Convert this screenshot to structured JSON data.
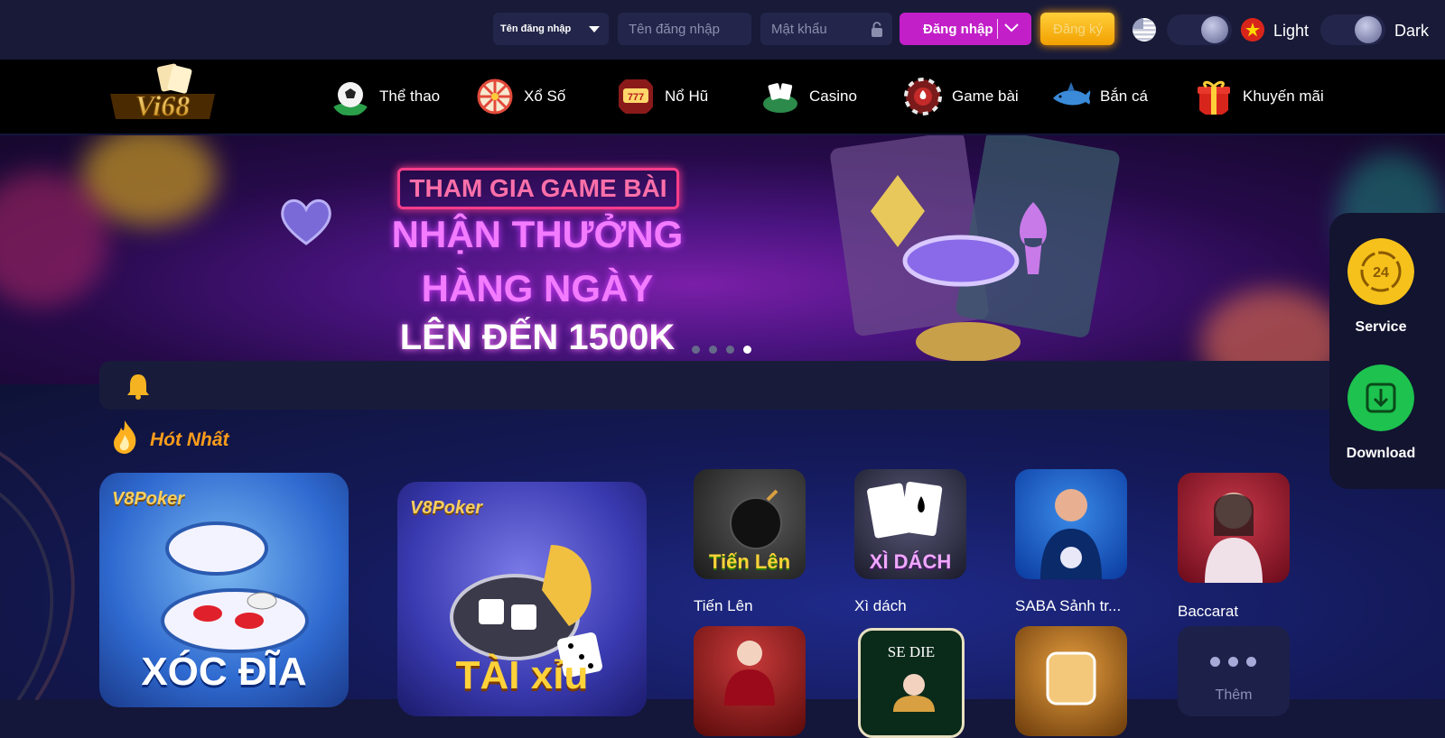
{
  "auth": {
    "login_type": "Tên đăng nhập",
    "username_placeholder": "Tên đăng nhập",
    "password_placeholder": "Mật khẩu",
    "login_label": "Đăng nhập",
    "register_label": "Đăng ký"
  },
  "theme": {
    "light_label": "Light",
    "dark_label": "Dark"
  },
  "brand": {
    "logo_text": "Vi68"
  },
  "nav": {
    "items": [
      {
        "label": "Thể thao",
        "icon": "soccer-ball-icon"
      },
      {
        "label": "Xổ Số",
        "icon": "lottery-wheel-icon"
      },
      {
        "label": "Nổ Hũ",
        "icon": "slot-machine-icon"
      },
      {
        "label": "Casino",
        "icon": "casino-cards-icon"
      },
      {
        "label": "Game bài",
        "icon": "poker-chip-icon"
      },
      {
        "label": "Bắn cá",
        "icon": "shark-icon"
      },
      {
        "label": "Khuyến mãi",
        "icon": "gift-box-icon"
      }
    ]
  },
  "banner": {
    "line1": "THAM GIA GAME BÀI",
    "line2": "NHẬN THƯỞNG",
    "line3": "HÀNG NGÀY",
    "line4": "LÊN ĐẾN 1500K",
    "slides": 4,
    "active_slide": 4
  },
  "dock": {
    "service_label": "Service",
    "service_badge": "24",
    "download_label": "Download"
  },
  "section": {
    "title": "Hót Nhất",
    "featured": [
      {
        "brand": "V8Poker",
        "title": "XÓC ĐĨA"
      },
      {
        "brand": "V8Poker",
        "title": "TÀI xỉu"
      }
    ],
    "games": [
      {
        "label": "Tiến Lên",
        "art": "Tiến Lên"
      },
      {
        "label": "Xì dách",
        "art": "XÌ DÁCH"
      },
      {
        "label": "SABA Sảnh tr...",
        "art": ""
      },
      {
        "label": "Baccarat",
        "art": ""
      }
    ],
    "games_row2": [
      {
        "art": ""
      },
      {
        "art": "SE DIE"
      },
      {
        "art": ""
      }
    ],
    "more_label": "Thêm"
  },
  "colors": {
    "login": "#c21fc8",
    "register": "#f2a000",
    "accent_orange": "#ff9d1a",
    "service": "#f6c11b",
    "download": "#1dc24f"
  }
}
